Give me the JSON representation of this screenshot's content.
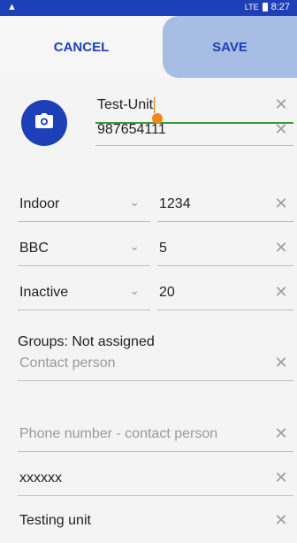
{
  "status_bar": {
    "time": "8:27",
    "network": "LTE"
  },
  "toolbar": {
    "cancel_label": "CANCEL",
    "save_label": "SAVE"
  },
  "form": {
    "name_value": "Test-Unit",
    "number_value": "987654111",
    "location_select": "Indoor",
    "location_code": "1234",
    "channel_select": "BBC",
    "channel_code": "5",
    "status_select": "Inactive",
    "status_code": "20",
    "groups_label": "Groups: Not assigned",
    "contact_person_placeholder": "Contact person",
    "contact_phone_placeholder": "Phone number - contact person",
    "extra_value": "xxxxxx",
    "description_value": "Testing unit"
  },
  "icons": {
    "warning": "warning-icon",
    "signal": "signal-icon",
    "battery": "battery-icon",
    "camera": "camera-icon",
    "clear": "close-icon",
    "dropdown": "chevron-down-icon"
  },
  "colors": {
    "primary": "#1d3fb7",
    "save_bg": "#a8bde3",
    "focus_underline": "#3a9a3a",
    "cursor": "#ef6c00"
  }
}
